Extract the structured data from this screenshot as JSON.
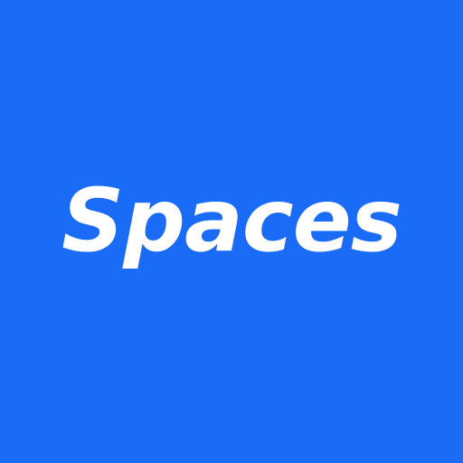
{
  "app_icon": {
    "logo_text": "Spaces",
    "colors": {
      "background": "#1A6BF5",
      "text": "#FFFFFF"
    }
  }
}
